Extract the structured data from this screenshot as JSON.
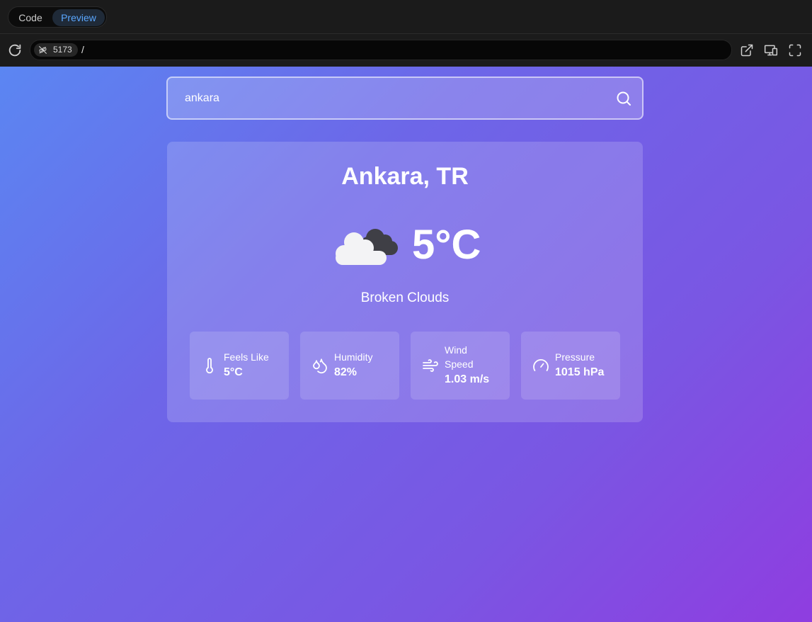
{
  "chrome": {
    "mode_tabs": [
      "Code",
      "Preview"
    ],
    "active_tab": "Preview",
    "port": "5173",
    "path": "/"
  },
  "search": {
    "value": "ankara"
  },
  "weather": {
    "city": "Ankara, TR",
    "icon": "broken-clouds-icon",
    "temperature": "5°C",
    "description": "Broken Clouds",
    "stats": [
      {
        "label": "Feels Like",
        "value": "5°C",
        "icon": "thermometer-icon"
      },
      {
        "label": "Humidity",
        "value": "82%",
        "icon": "droplets-icon"
      },
      {
        "label_line1": "Wind",
        "label_line2": "Speed",
        "value": "1.03 m/s",
        "icon": "wind-icon"
      },
      {
        "label": "Pressure",
        "value": "1015 hPa",
        "icon": "gauge-icon"
      }
    ]
  },
  "colors": {
    "gradient_start": "#5b86f2",
    "gradient_end": "#8f3de0",
    "accent": "#5aa7ff"
  }
}
